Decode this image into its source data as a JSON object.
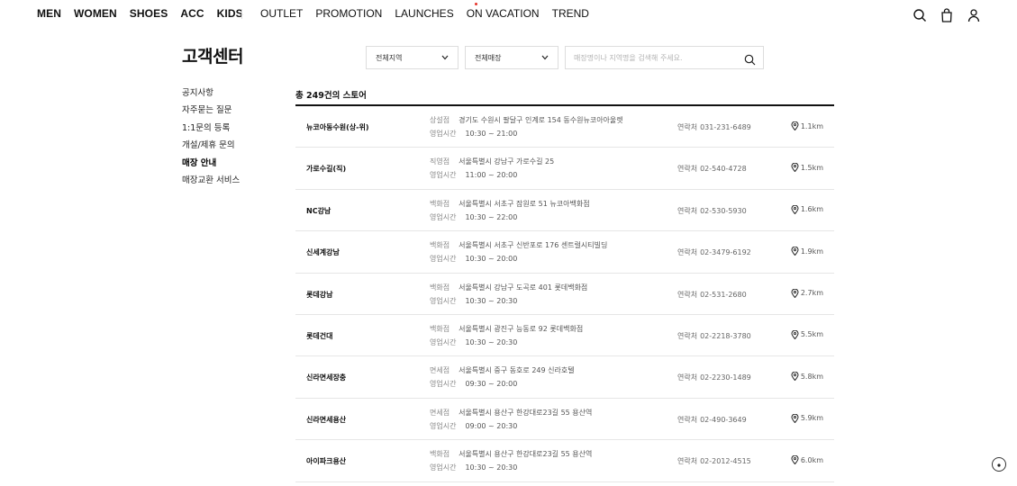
{
  "nav": {
    "main": [
      "MEN",
      "WOMEN",
      "SHOES",
      "ACC",
      "KIDS"
    ],
    "sub": [
      "OUTLET",
      "PROMOTION",
      "LAUNCHES",
      "ON VACATION",
      "TREND"
    ]
  },
  "page_title": "고객센터",
  "sidebar": {
    "items": [
      {
        "label": "공지사항"
      },
      {
        "label": "자주묻는 질문"
      },
      {
        "label": "1:1문의 등록"
      },
      {
        "label": "개설/제휴 문의"
      },
      {
        "label": "매장 안내"
      },
      {
        "label": "매장교환 서비스"
      }
    ],
    "active": "매장 안내"
  },
  "filters": {
    "region": "전체지역",
    "store": "전체매장",
    "search_placeholder": "매장명이나 지역명을 검색해 주세요."
  },
  "total_label": "총 249건의 스토어",
  "labels": {
    "hours": "영업시간",
    "contact": "연락처"
  },
  "stores": [
    {
      "name": "뉴코아동수원(상-위)",
      "type": "상설점",
      "address": "경기도 수원시 팔달구 인계로 154 동수원뉴코아아울렛",
      "hours": "10:30 ~ 21:00",
      "phone": "031-231-6489",
      "distance": "1.1km"
    },
    {
      "name": "가로수길(직)",
      "type": "직영점",
      "address": "서울특별시 강남구 가로수길 25",
      "hours": "11:00 ~ 20:00",
      "phone": "02-540-4728",
      "distance": "1.5km"
    },
    {
      "name": "NC강남",
      "type": "백화점",
      "address": "서울특별시 서초구 잠원로 51 뉴코아백화점",
      "hours": "10:30 ~ 22:00",
      "phone": "02-530-5930",
      "distance": "1.6km"
    },
    {
      "name": "신세계강남",
      "type": "백화점",
      "address": "서울특별시 서초구 신반포로 176 센트럴시티빌딩",
      "hours": "10:30 ~ 20:00",
      "phone": "02-3479-6192",
      "distance": "1.9km"
    },
    {
      "name": "롯데강남",
      "type": "백화점",
      "address": "서울특별시 강남구 도곡로 401 롯데백화점",
      "hours": "10:30 ~ 20:30",
      "phone": "02-531-2680",
      "distance": "2.7km"
    },
    {
      "name": "롯데건대",
      "type": "백화점",
      "address": "서울특별시 광진구 능동로 92 롯데백화점",
      "hours": "10:30 ~ 20:30",
      "phone": "02-2218-3780",
      "distance": "5.5km"
    },
    {
      "name": "신라면세장충",
      "type": "면세점",
      "address": "서울특별시 중구 동호로 249 신라호텔",
      "hours": "09:30 ~ 20:00",
      "phone": "02-2230-1489",
      "distance": "5.8km"
    },
    {
      "name": "신라면세용산",
      "type": "면세점",
      "address": "서울특별시 용산구 한강대로23길 55 용산역",
      "hours": "09:00 ~ 20:30",
      "phone": "02-490-3649",
      "distance": "5.9km"
    },
    {
      "name": "아이파크용산",
      "type": "백화점",
      "address": "서울특별시 용산구 한강대로23길 55 용산역",
      "hours": "10:30 ~ 20:30",
      "phone": "02-2012-4515",
      "distance": "6.0km"
    }
  ]
}
